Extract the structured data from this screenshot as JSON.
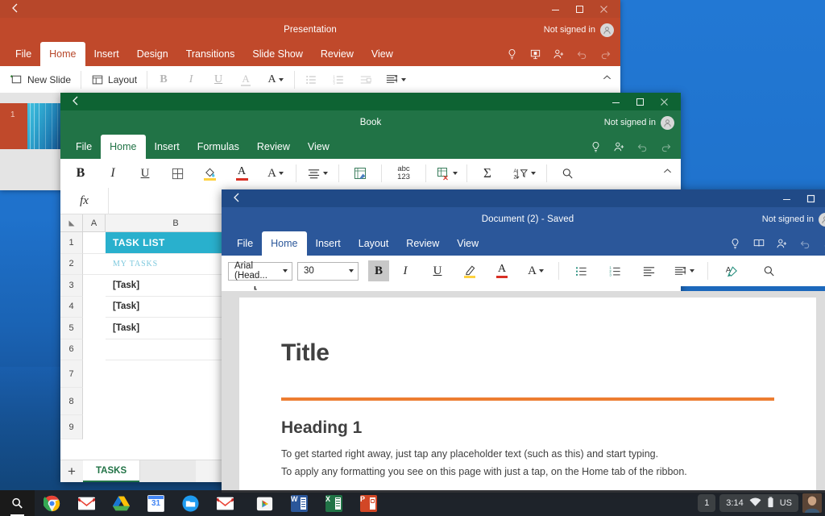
{
  "desktop": {
    "wallpaper_color": "#1f72cc"
  },
  "powerpoint": {
    "app": "PowerPoint",
    "accent": "#c0492b",
    "title": "Presentation",
    "account": "Not signed in",
    "back_icon": "back-arrow-icon",
    "window_buttons": [
      "minimize-icon",
      "maximize-icon",
      "close-icon"
    ],
    "tabs": [
      {
        "label": "File",
        "active": false
      },
      {
        "label": "Home",
        "active": true
      },
      {
        "label": "Insert",
        "active": false
      },
      {
        "label": "Design",
        "active": false
      },
      {
        "label": "Transitions",
        "active": false
      },
      {
        "label": "Slide Show",
        "active": false
      },
      {
        "label": "Review",
        "active": false
      },
      {
        "label": "View",
        "active": false
      }
    ],
    "tab_icons": [
      "lightbulb-icon",
      "present-icon",
      "share-person-icon",
      "undo-icon",
      "redo-icon"
    ],
    "ribbon": [
      {
        "name": "new-slide-button",
        "label": "New Slide",
        "icon": "new-slide-icon"
      },
      {
        "name": "layout-button",
        "label": "Layout",
        "icon": "layout-icon"
      },
      {
        "name": "bold-button",
        "label": "B",
        "icon": "bold-icon"
      },
      {
        "name": "italic-button",
        "label": "I",
        "icon": "italic-icon"
      },
      {
        "name": "underline-button",
        "label": "U",
        "icon": "underline-icon"
      },
      {
        "name": "text-color-button",
        "label": "A",
        "icon": "font-color-icon"
      },
      {
        "name": "font-size-button",
        "label": "A",
        "icon": "font-format-icon"
      },
      {
        "name": "bullets-button",
        "label": "",
        "icon": "bullet-list-icon"
      },
      {
        "name": "numbering-button",
        "label": "",
        "icon": "numbered-list-icon"
      },
      {
        "name": "indent-button",
        "label": "",
        "icon": "indent-icon"
      },
      {
        "name": "paragraph-button",
        "label": "",
        "icon": "paragraph-icon"
      }
    ],
    "slide_panel": {
      "slide_number": "1"
    }
  },
  "excel": {
    "app": "Excel",
    "accent": "#217346",
    "title": "Book",
    "account": "Not signed in",
    "back_icon": "back-arrow-icon",
    "tabs": [
      {
        "label": "File",
        "active": false
      },
      {
        "label": "Home",
        "active": true
      },
      {
        "label": "Insert",
        "active": false
      },
      {
        "label": "Formulas",
        "active": false
      },
      {
        "label": "Review",
        "active": false
      },
      {
        "label": "View",
        "active": false
      }
    ],
    "tab_icons": [
      "lightbulb-icon",
      "share-person-icon",
      "undo-icon",
      "redo-icon"
    ],
    "ribbon": [
      {
        "name": "bold-button",
        "label": "B",
        "icon": "bold-icon"
      },
      {
        "name": "italic-button",
        "label": "I",
        "icon": "italic-icon"
      },
      {
        "name": "underline-button",
        "label": "U",
        "icon": "underline-icon"
      },
      {
        "name": "borders-button",
        "label": "",
        "icon": "borders-icon"
      },
      {
        "name": "fill-color-button",
        "label": "",
        "icon": "fill-color-icon"
      },
      {
        "name": "font-color-button",
        "label": "A",
        "icon": "font-color-icon"
      },
      {
        "name": "font-format-button",
        "label": "A",
        "icon": "font-format-icon"
      },
      {
        "name": "align-button",
        "label": "",
        "icon": "align-icon"
      },
      {
        "name": "wrap-text-button",
        "label": "",
        "icon": "wrap-text-icon"
      },
      {
        "name": "number-format-button",
        "label": "abc 123",
        "icon": "number-format-icon"
      },
      {
        "name": "insert-cells-button",
        "label": "",
        "icon": "insert-cells-icon"
      },
      {
        "name": "autosum-button",
        "label": "Σ",
        "icon": "autosum-icon"
      },
      {
        "name": "sort-filter-button",
        "label": "",
        "icon": "sort-filter-icon"
      },
      {
        "name": "find-button",
        "label": "",
        "icon": "search-icon"
      }
    ],
    "formula_bar": {
      "fx_label": "fx",
      "value": "",
      "placeholder": ""
    },
    "grid": {
      "columns": [
        "A",
        "B"
      ],
      "rows": [
        "1",
        "2",
        "3",
        "4",
        "5",
        "6",
        "7",
        "8",
        "9"
      ],
      "cells": {
        "B1": "TASK LIST",
        "B2": "MY  TASKS",
        "B3": "[Task]",
        "B4": "[Task]",
        "B5": "[Task]"
      },
      "header_fill": "#29b0cd"
    },
    "sheet_tabs": [
      {
        "label": "TASKS",
        "active": true
      }
    ],
    "add_sheet_label": "+"
  },
  "word": {
    "app": "Word",
    "accent": "#2b579a",
    "title": "Document (2) - Saved",
    "account": "Not signed in",
    "back_icon": "back-arrow-icon",
    "tabs": [
      {
        "label": "File",
        "active": false
      },
      {
        "label": "Home",
        "active": true
      },
      {
        "label": "Insert",
        "active": false
      },
      {
        "label": "Layout",
        "active": false
      },
      {
        "label": "Review",
        "active": false
      },
      {
        "label": "View",
        "active": false
      }
    ],
    "tab_icons": [
      "lightbulb-icon",
      "read-mode-icon",
      "share-person-icon",
      "undo-icon",
      "redo-icon"
    ],
    "font_name": "Arial (Head...",
    "font_size": "30",
    "ribbon": [
      {
        "name": "bold-button",
        "label": "B",
        "icon": "bold-icon",
        "active": true
      },
      {
        "name": "italic-button",
        "label": "I",
        "icon": "italic-icon"
      },
      {
        "name": "underline-button",
        "label": "U",
        "icon": "underline-icon"
      },
      {
        "name": "highlight-button",
        "label": "",
        "icon": "highlighter-icon"
      },
      {
        "name": "font-color-button",
        "label": "A",
        "icon": "font-color-icon"
      },
      {
        "name": "font-format-button",
        "label": "A",
        "icon": "font-format-icon"
      },
      {
        "name": "bullets-button",
        "label": "",
        "icon": "bullet-list-icon"
      },
      {
        "name": "numbering-button",
        "label": "",
        "icon": "numbered-list-icon"
      },
      {
        "name": "align-left-button",
        "label": "",
        "icon": "align-left-icon"
      },
      {
        "name": "paragraph-button",
        "label": "",
        "icon": "paragraph-icon"
      },
      {
        "name": "format-painter-button",
        "label": "",
        "icon": "format-painter-icon"
      },
      {
        "name": "find-button",
        "label": "",
        "icon": "search-icon"
      }
    ],
    "document": {
      "title": "Title",
      "rule_color": "#ed7d31",
      "heading1": "Heading 1",
      "paragraph1": "To get started right away, just tap any placeholder text (such as this) and start typing.",
      "paragraph2": "To apply any formatting you see on this page with just a tap, on the Home tab of the ribbon."
    }
  },
  "taskbar": {
    "launcher": [
      {
        "name": "search-icon",
        "label": ""
      },
      {
        "name": "chrome-icon",
        "label": ""
      },
      {
        "name": "gmail-icon",
        "label": ""
      },
      {
        "name": "google-drive-icon",
        "label": ""
      },
      {
        "name": "calendar-icon",
        "label": "31"
      },
      {
        "name": "files-icon",
        "label": ""
      },
      {
        "name": "gmail-icon",
        "label": ""
      },
      {
        "name": "play-store-icon",
        "label": ""
      },
      {
        "name": "word-icon",
        "label": "W"
      },
      {
        "name": "excel-icon",
        "label": "X"
      },
      {
        "name": "powerpoint-icon",
        "label": "P"
      }
    ],
    "tray": {
      "notification_count": "1",
      "time": "3:14",
      "wifi_icon": "wifi-icon",
      "battery_icon": "battery-icon",
      "keyboard_layout": "US",
      "avatar": "user-avatar"
    }
  }
}
